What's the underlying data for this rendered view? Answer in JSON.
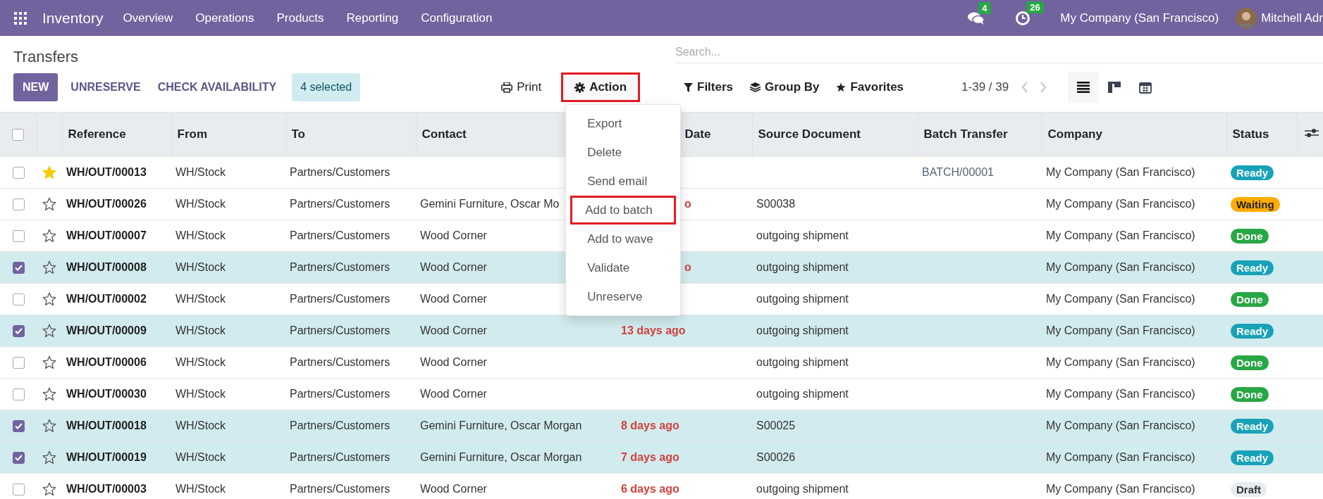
{
  "navbar": {
    "app": "Inventory",
    "menu": [
      "Overview",
      "Operations",
      "Products",
      "Reporting",
      "Configuration"
    ],
    "messages_count": "4",
    "activities_count": "26",
    "company": "My Company (San Francisco)",
    "user": "Mitchell Adr"
  },
  "title": "Transfers",
  "buttons": {
    "new": "NEW",
    "unreserve": "UNRESERVE",
    "check": "CHECK AVAILABILITY",
    "selected_count": "4 selected",
    "print": "Print",
    "action": "Action"
  },
  "action_menu": [
    {
      "label": "Export",
      "highlighted": false
    },
    {
      "label": "Delete",
      "highlighted": false
    },
    {
      "label": "Send email",
      "highlighted": false
    },
    {
      "label": "Add to batch",
      "highlighted": true
    },
    {
      "label": "Add to wave",
      "highlighted": false
    },
    {
      "label": "Validate",
      "highlighted": false
    },
    {
      "label": "Unreserve",
      "highlighted": false
    }
  ],
  "search": {
    "placeholder": "Search..."
  },
  "filters": [
    "Filters",
    "Group By",
    "Favorites"
  ],
  "pager": "1-39 / 39",
  "all_selected": false,
  "columns": [
    {
      "label": "Reference",
      "clipped": false
    },
    {
      "label": "From",
      "clipped": false
    },
    {
      "label": "To",
      "clipped": false
    },
    {
      "label": "Contact",
      "clipped": false
    },
    {
      "label": "Date",
      "clipped": true
    },
    {
      "label": "Source Document",
      "clipped": false
    },
    {
      "label": "Batch Transfer",
      "clipped": false
    },
    {
      "label": "Company",
      "clipped": false
    },
    {
      "label": "Status",
      "clipped": false
    }
  ],
  "rows": [
    {
      "selected": false,
      "starred": true,
      "reference": "WH/OUT/00013",
      "from": "WH/Stock",
      "to": "Partners/Customers",
      "contact": "",
      "date": "",
      "source": "",
      "batch": "BATCH/00001",
      "company": "My Company (San Francisco)",
      "status": {
        "label": "Ready",
        "kind": "ready"
      }
    },
    {
      "selected": false,
      "starred": false,
      "reference": "WH/OUT/00026",
      "from": "WH/Stock",
      "to": "Partners/Customers",
      "contact": "Gemini Furniture, Oscar Mo",
      "date": "o",
      "date_clipped": true,
      "source": "S00038",
      "batch": "",
      "company": "My Company (San Francisco)",
      "status": {
        "label": "Waiting",
        "kind": "waiting"
      }
    },
    {
      "selected": false,
      "starred": false,
      "reference": "WH/OUT/00007",
      "from": "WH/Stock",
      "to": "Partners/Customers",
      "contact": "Wood Corner",
      "date": "",
      "source": "outgoing shipment",
      "batch": "",
      "company": "My Company (San Francisco)",
      "status": {
        "label": "Done",
        "kind": "done"
      }
    },
    {
      "selected": true,
      "starred": false,
      "reference": "WH/OUT/00008",
      "from": "WH/Stock",
      "to": "Partners/Customers",
      "contact": "Wood Corner",
      "date": "o",
      "date_clipped": true,
      "source": "outgoing shipment",
      "batch": "",
      "company": "My Company (San Francisco)",
      "status": {
        "label": "Ready",
        "kind": "ready"
      }
    },
    {
      "selected": false,
      "starred": false,
      "reference": "WH/OUT/00002",
      "from": "WH/Stock",
      "to": "Partners/Customers",
      "contact": "Wood Corner",
      "date": "",
      "source": "outgoing shipment",
      "batch": "",
      "company": "My Company (San Francisco)",
      "status": {
        "label": "Done",
        "kind": "done"
      }
    },
    {
      "selected": true,
      "starred": false,
      "reference": "WH/OUT/00009",
      "from": "WH/Stock",
      "to": "Partners/Customers",
      "contact": "Wood Corner",
      "date": "13 days ago",
      "date_clipped": false,
      "source": "outgoing shipment",
      "batch": "",
      "company": "My Company (San Francisco)",
      "status": {
        "label": "Ready",
        "kind": "ready"
      }
    },
    {
      "selected": false,
      "starred": false,
      "reference": "WH/OUT/00006",
      "from": "WH/Stock",
      "to": "Partners/Customers",
      "contact": "Wood Corner",
      "date": "",
      "source": "outgoing shipment",
      "batch": "",
      "company": "My Company (San Francisco)",
      "status": {
        "label": "Done",
        "kind": "done"
      }
    },
    {
      "selected": false,
      "starred": false,
      "reference": "WH/OUT/00030",
      "from": "WH/Stock",
      "to": "Partners/Customers",
      "contact": "Wood Corner",
      "date": "",
      "source": "outgoing shipment",
      "batch": "",
      "company": "My Company (San Francisco)",
      "status": {
        "label": "Done",
        "kind": "done"
      }
    },
    {
      "selected": true,
      "starred": false,
      "reference": "WH/OUT/00018",
      "from": "WH/Stock",
      "to": "Partners/Customers",
      "contact": "Gemini Furniture, Oscar Morgan",
      "date": "8 days ago",
      "date_clipped": false,
      "source": "S00025",
      "batch": "",
      "company": "My Company (San Francisco)",
      "status": {
        "label": "Ready",
        "kind": "ready"
      }
    },
    {
      "selected": true,
      "starred": false,
      "reference": "WH/OUT/00019",
      "from": "WH/Stock",
      "to": "Partners/Customers",
      "contact": "Gemini Furniture, Oscar Morgan",
      "date": "7 days ago",
      "date_clipped": false,
      "source": "S00026",
      "batch": "",
      "company": "My Company (San Francisco)",
      "status": {
        "label": "Ready",
        "kind": "ready"
      }
    },
    {
      "selected": false,
      "starred": false,
      "reference": "WH/OUT/00003",
      "from": "WH/Stock",
      "to": "Partners/Customers",
      "contact": "Wood Corner",
      "date": "6 days ago",
      "date_clipped": false,
      "source": "outgoing shipment",
      "batch": "",
      "company": "My Company (San Francisco)",
      "status": {
        "label": "Draft",
        "kind": "draft"
      }
    }
  ]
}
